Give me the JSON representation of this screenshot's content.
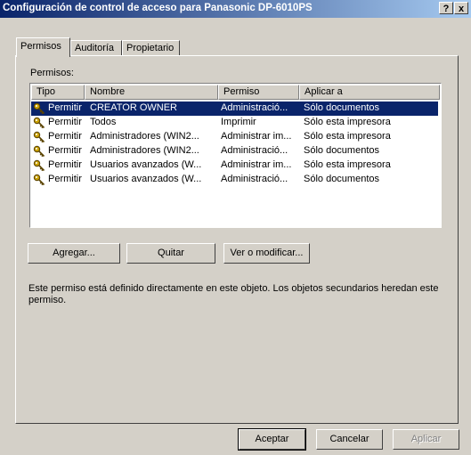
{
  "window": {
    "title": "Configuración de control de acceso para Panasonic DP-6010PS",
    "help_label": "?",
    "close_label": "x"
  },
  "tabs": [
    {
      "label": "Permisos"
    },
    {
      "label": "Auditoría"
    },
    {
      "label": "Propietario"
    }
  ],
  "permissions_label": "Permisos:",
  "columns": [
    {
      "label": "Tipo"
    },
    {
      "label": "Nombre"
    },
    {
      "label": "Permiso"
    },
    {
      "label": "Aplicar a"
    }
  ],
  "rows": [
    {
      "tipo": "Permitir",
      "nombre": "CREATOR OWNER",
      "permiso": "Administració...",
      "aplicar": "Sólo documentos",
      "selected": true
    },
    {
      "tipo": "Permitir",
      "nombre": "Todos",
      "permiso": "Imprimir",
      "aplicar": "Sólo esta impresora"
    },
    {
      "tipo": "Permitir",
      "nombre": "Administradores (WIN2...",
      "permiso": "Administrar im...",
      "aplicar": "Sólo esta impresora"
    },
    {
      "tipo": "Permitir",
      "nombre": "Administradores (WIN2...",
      "permiso": "Administració...",
      "aplicar": "Sólo documentos"
    },
    {
      "tipo": "Permitir",
      "nombre": "Usuarios avanzados (W...",
      "permiso": "Administrar im...",
      "aplicar": "Sólo esta impresora"
    },
    {
      "tipo": "Permitir",
      "nombre": "Usuarios avanzados (W...",
      "permiso": "Administració...",
      "aplicar": "Sólo documentos"
    }
  ],
  "buttons": {
    "add": "Agregar...",
    "remove": "Quitar",
    "view": "Ver o modificar..."
  },
  "description": "Este permiso está definido directamente en este objeto. Los objetos secundarios heredan este permiso.",
  "footer": {
    "ok": "Aceptar",
    "cancel": "Cancelar",
    "apply": "Aplicar"
  },
  "colors": {
    "title_start": "#0a246a",
    "title_end": "#a6caf0",
    "selection": "#0a246a",
    "face": "#d4d0c8"
  },
  "icons": {
    "row_icon": "key-icon"
  }
}
